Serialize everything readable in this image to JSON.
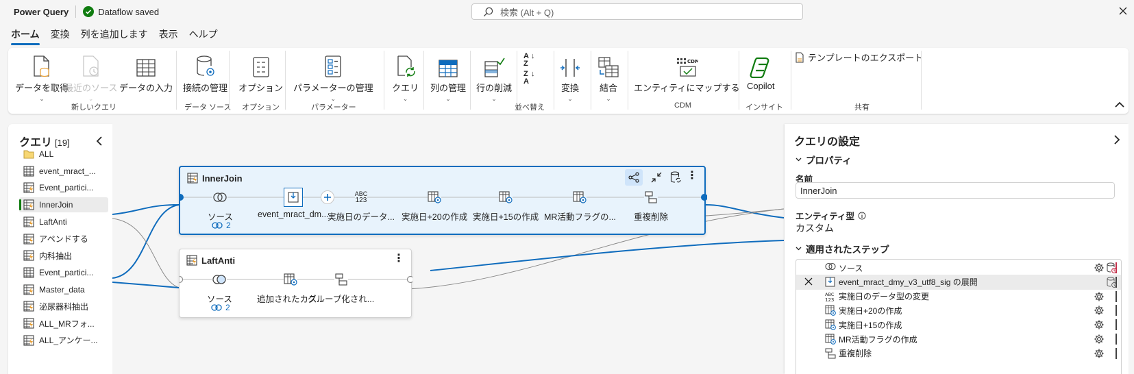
{
  "app": {
    "title": "Power Query",
    "status": "Dataflow saved"
  },
  "search": {
    "placeholder": "検索 (Alt + Q)"
  },
  "menu_tabs": [
    "ホーム",
    "変換",
    "列を追加します",
    "表示",
    "ヘルプ"
  ],
  "ribbon": {
    "buttons": {
      "get_data": "データを取得",
      "recent_sources": "最近のソース",
      "enter_data": "データの入力",
      "manage_connections": "接続の管理",
      "options": "オプション",
      "manage_parameters": "パラメーターの管理",
      "query": "クエリ",
      "manage_columns": "列の管理",
      "remove_rows": "行の削減",
      "transform": "変換",
      "combine": "結合",
      "map_to_entity": "エンティティにマップする",
      "copilot": "Copilot",
      "export_template": "テンプレートのエクスポート"
    },
    "groups": {
      "new_query": "新しいクエリ",
      "data_source": "データ ソース",
      "options": "オプション",
      "parameters": "パラメーター",
      "sort": "並べ替え",
      "cdm": "CDM",
      "insights": "インサイト",
      "share": "共有"
    }
  },
  "queries": {
    "title": "クエリ",
    "count": "[19]",
    "items": [
      {
        "label": "ALL",
        "icon": "folder-icon"
      },
      {
        "label": "event_mract_...",
        "icon": "table-icon"
      },
      {
        "label": "Event_partici...",
        "icon": "table-lightning-icon"
      },
      {
        "label": "InnerJoin",
        "icon": "table-lightning-icon"
      },
      {
        "label": "LaftAnti",
        "icon": "table-lightning-icon"
      },
      {
        "label": "アペンドする",
        "icon": "table-lightning-icon"
      },
      {
        "label": "内科抽出",
        "icon": "table-lightning-icon"
      },
      {
        "label": "Event_partici...",
        "icon": "table-icon"
      },
      {
        "label": "Master_data",
        "icon": "table-lightning-icon"
      },
      {
        "label": "泌尿器科抽出",
        "icon": "table-lightning-icon"
      },
      {
        "label": "ALL_MRフォ...",
        "icon": "table-lightning-icon"
      },
      {
        "label": "ALL_アンケー...",
        "icon": "table-lightning-icon"
      }
    ]
  },
  "diagram": {
    "innerjoin": {
      "title": "InnerJoin",
      "links": "2",
      "steps": [
        "ソース",
        "event_mract_dm...",
        "実施日のデータ...",
        "実施日+20の作成",
        "実施日+15の作成",
        "MR活動フラグの...",
        "重複削除"
      ]
    },
    "laftanti": {
      "title": "LaftAnti",
      "links": "2",
      "steps": [
        "ソース",
        "追加されたカス...",
        "グループ化され..."
      ]
    }
  },
  "settings": {
    "title": "クエリの設定",
    "properties": "プロパティ",
    "name_label": "名前",
    "name_value": "InnerJoin",
    "entity_type_label": "エンティティ型",
    "entity_type_value": "カスタム",
    "applied_steps": "適用されたステップ",
    "steps": [
      {
        "label": "ソース",
        "icon": "merge-circles-icon"
      },
      {
        "label": "event_mract_dmy_v3_utf8_sig の展開",
        "icon": "expand-column-icon"
      },
      {
        "label": "実施日のデータ型の変更",
        "icon": "abc123-icon"
      },
      {
        "label": "実施日+20の作成",
        "icon": "custom-column-icon"
      },
      {
        "label": "実施日+15の作成",
        "icon": "custom-column-icon"
      },
      {
        "label": "MR活動フラグの作成",
        "icon": "custom-column-icon"
      },
      {
        "label": "重複削除",
        "icon": "remove-duplicates-icon"
      }
    ]
  },
  "colors": {
    "accent": "#0f6cbd",
    "success": "#107c10",
    "lightning": "#e8a33d"
  }
}
